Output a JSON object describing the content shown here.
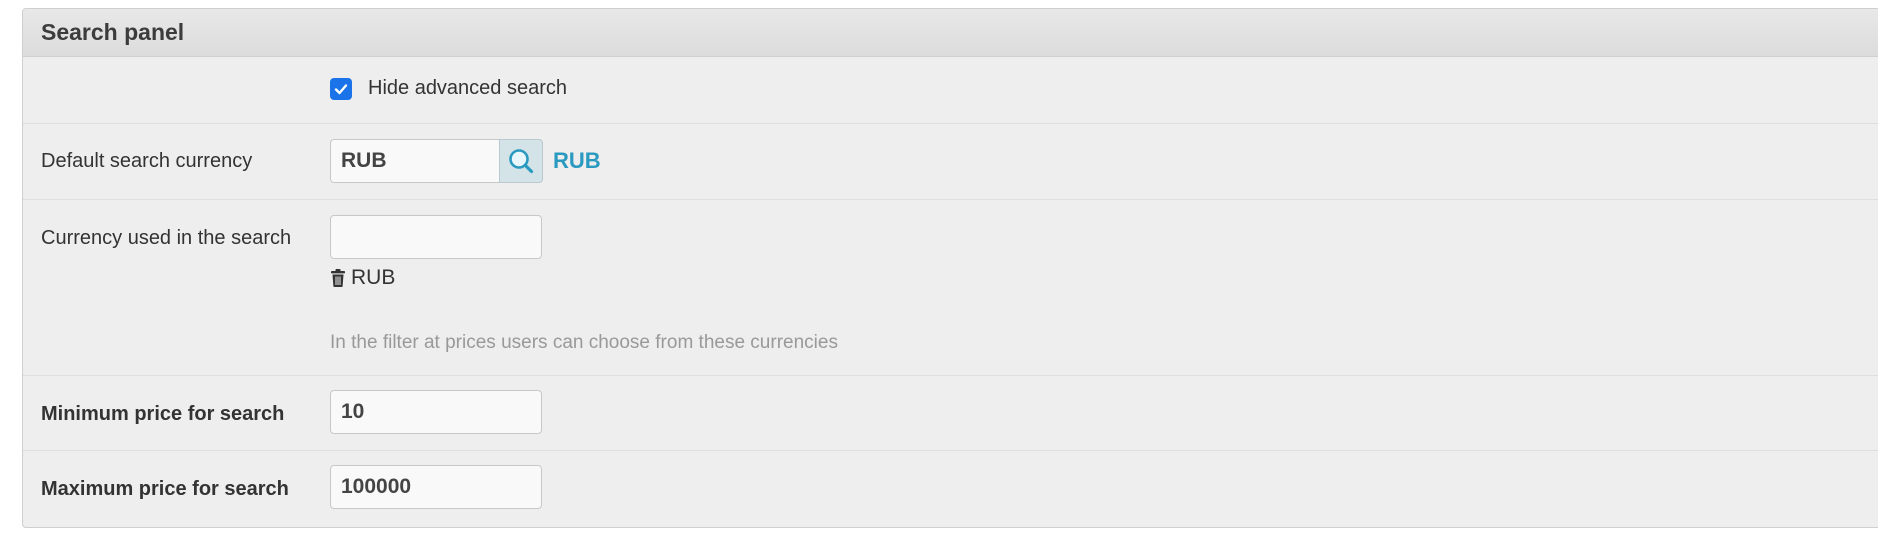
{
  "panel": {
    "title": "Search panel"
  },
  "hide_advanced": {
    "label": "Hide advanced search",
    "checked": true
  },
  "default_currency": {
    "label": "Default search currency",
    "input_value": "RUB",
    "lookup_icon": "search-icon",
    "selected_link": "RUB"
  },
  "currencies_used": {
    "label": "Currency used in the search",
    "input_value": "",
    "remove_icon": "trash-icon",
    "selected": [
      "RUB"
    ],
    "help": "In the filter at prices users can choose from these currencies"
  },
  "min_price": {
    "label": "Minimum price for search",
    "value": "10"
  },
  "max_price": {
    "label": "Maximum price for search",
    "value": "100000"
  },
  "colors": {
    "checkbox": "#1a73e8",
    "link": "#2a9ac0",
    "help": "#999999"
  }
}
